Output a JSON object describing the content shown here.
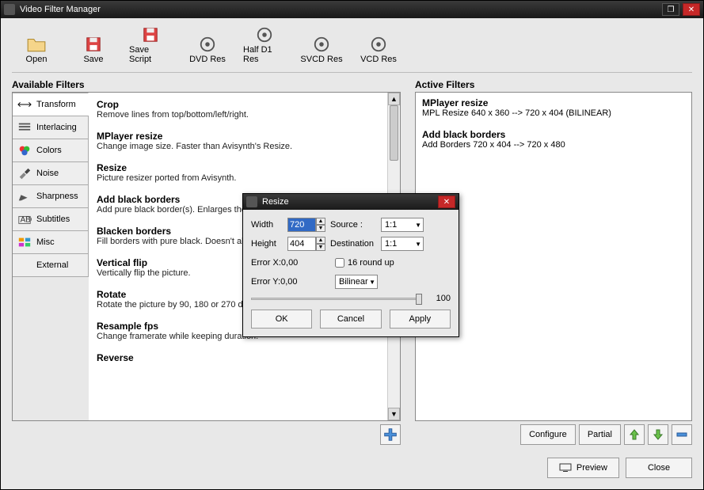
{
  "title": "Video Filter Manager",
  "toolbar": [
    {
      "name": "open-tool",
      "label": "Open",
      "icon": "folder"
    },
    {
      "name": "save-tool",
      "label": "Save",
      "icon": "floppy"
    },
    {
      "name": "save-script-tool",
      "label": "Save Script",
      "icon": "floppy"
    },
    {
      "name": "dvd-res-tool",
      "label": "DVD Res",
      "icon": "disc"
    },
    {
      "name": "half-d1-res-tool",
      "label": "Half D1 Res",
      "icon": "disc"
    },
    {
      "name": "svcd-res-tool",
      "label": "SVCD Res",
      "icon": "disc"
    },
    {
      "name": "vcd-res-tool",
      "label": "VCD Res",
      "icon": "disc"
    }
  ],
  "labels": {
    "available": "Available Filters",
    "active": "Active Filters",
    "add": "+",
    "configure": "Configure",
    "partial": "Partial",
    "up": "↑",
    "down": "↓",
    "remove": "−",
    "preview": "Preview",
    "close": "Close"
  },
  "categories": [
    {
      "name": "transform",
      "label": "Transform",
      "icon": "arrows",
      "active": true
    },
    {
      "name": "interlacing",
      "label": "Interlacing",
      "icon": "lines"
    },
    {
      "name": "colors",
      "label": "Colors",
      "icon": "rgb"
    },
    {
      "name": "noise",
      "label": "Noise",
      "icon": "brush"
    },
    {
      "name": "sharpness",
      "label": "Sharpness",
      "icon": "pen"
    },
    {
      "name": "subtitles",
      "label": "Subtitles",
      "icon": "abc"
    },
    {
      "name": "misc",
      "label": "Misc",
      "icon": "misc"
    },
    {
      "name": "external",
      "label": "External",
      "icon": ""
    }
  ],
  "filters": [
    {
      "name": "Crop",
      "desc": "Remove lines from top/bottom/left/right."
    },
    {
      "name": "MPlayer resize",
      "desc": "Change image size. Faster than Avisynth's Resize."
    },
    {
      "name": "Resize",
      "desc": "Picture resizer ported from Avisynth."
    },
    {
      "name": "Add black borders",
      "desc": "Add pure black border(s). Enlarges the picture."
    },
    {
      "name": "Blacken borders",
      "desc": "Fill borders with pure black. Doesn't alter size."
    },
    {
      "name": "Vertical flip",
      "desc": "Vertically flip the picture."
    },
    {
      "name": "Rotate",
      "desc": "Rotate the picture by 90, 180 or 270 degrees."
    },
    {
      "name": "Resample fps",
      "desc": "Change framerate while keeping duration."
    },
    {
      "name": "Reverse",
      "desc": ""
    }
  ],
  "active_filters": [
    {
      "name": "MPlayer resize",
      "desc": "MPL Resize 640 x 360 --> 720 x 404 (BILINEAR)"
    },
    {
      "name": "Add black borders",
      "desc": "Add Borders 720 x 404 --> 720 x 480"
    }
  ],
  "resize": {
    "title": "Resize",
    "width_label": "Width",
    "height_label": "Height",
    "width": "720",
    "height": "404",
    "source_label": "Source :",
    "dest_label": "Destination",
    "source_ratio": "1:1",
    "dest_ratio": "1:1",
    "errx": "Error X:0,00",
    "erry": "Error Y:0,00",
    "roundup_label": "16 round up",
    "roundup": false,
    "method": "Bilinear",
    "slider_val": "100",
    "ok": "OK",
    "cancel": "Cancel",
    "apply": "Apply"
  }
}
